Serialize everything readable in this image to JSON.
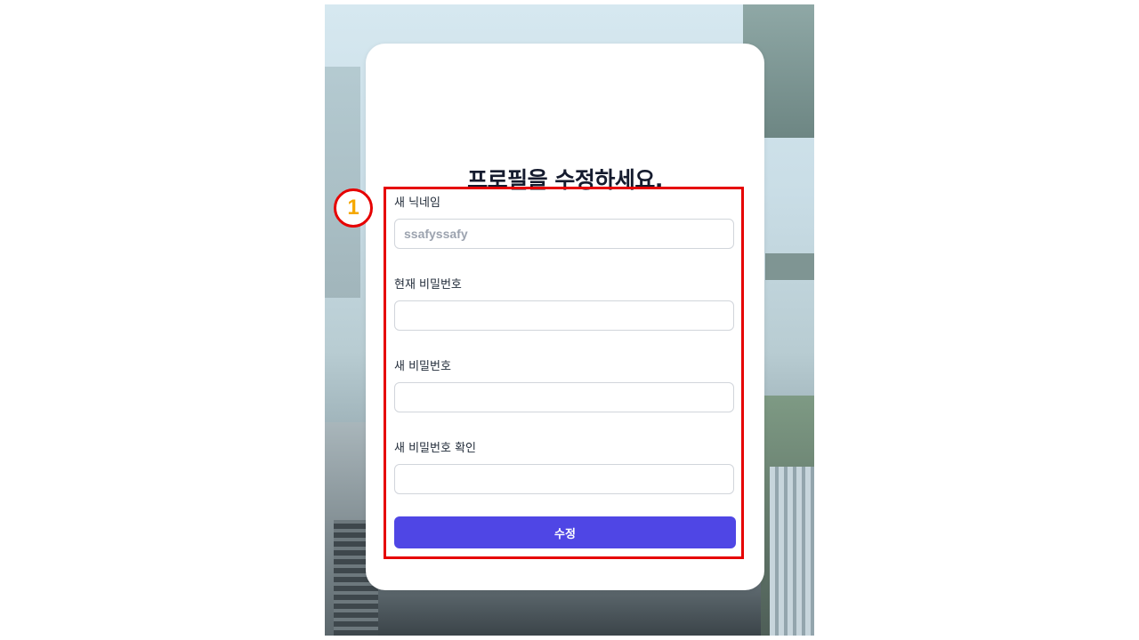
{
  "form": {
    "title": "프로필을 수정하세요.",
    "nickname_label": "새 닉네임",
    "nickname_placeholder": "ssafyssafy",
    "current_password_label": "현재 비밀번호",
    "new_password_label": "새 비밀번호",
    "confirm_password_label": "새 비밀번호 확인",
    "submit_label": "수정"
  },
  "annotation": {
    "marker_number": "1",
    "highlight_color": "#e60000",
    "marker_color": "#f5a800"
  },
  "colors": {
    "accent": "#4f46e5"
  }
}
